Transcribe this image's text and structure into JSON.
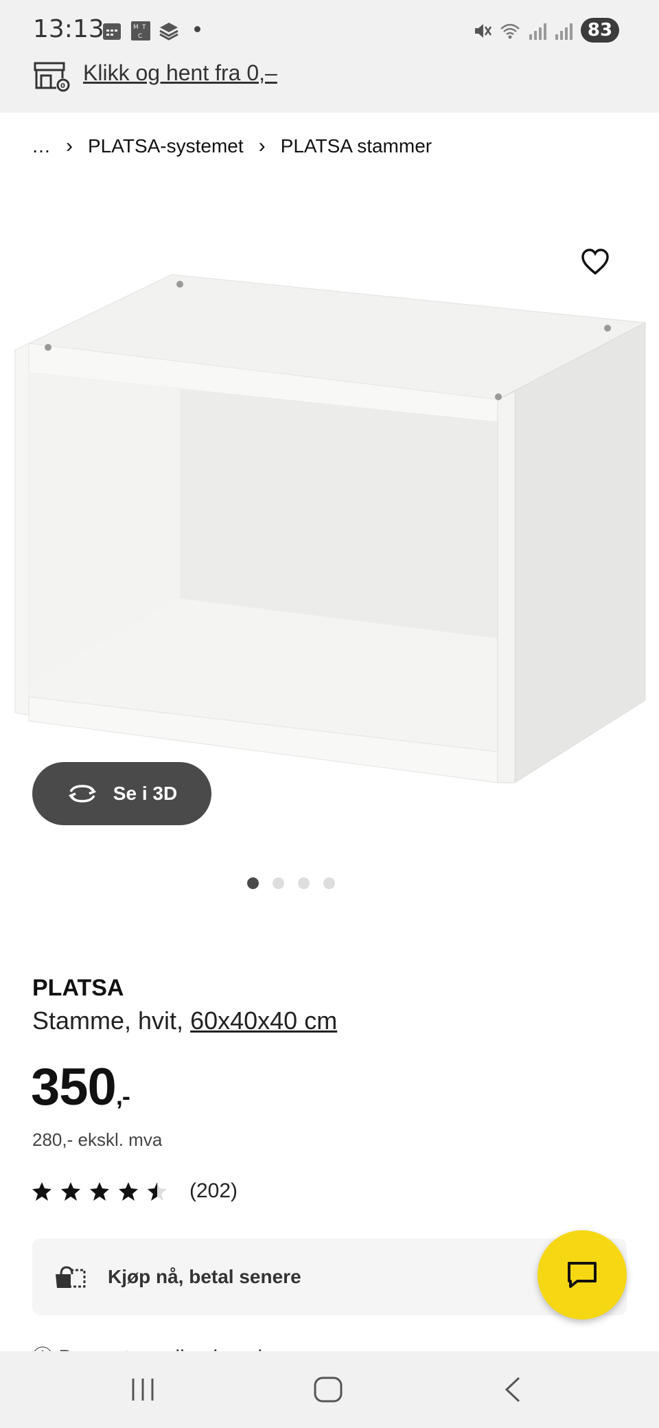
{
  "status_bar": {
    "time": "13:13",
    "battery": "83",
    "icons": [
      "calendar-icon",
      "mtc-icon",
      "stack-icon",
      "mute-icon",
      "wifi-icon",
      "signal-icon",
      "signal-r-icon"
    ]
  },
  "promo": {
    "text": "Klikk og hent fra 0,–",
    "icon": "store-pickup-icon"
  },
  "breadcrumb": {
    "items": [
      "…",
      "PLATSA-systemet",
      "PLATSA stammer"
    ]
  },
  "gallery": {
    "view_3d_label": "Se i 3D",
    "dot_count": 4,
    "active_index": 0
  },
  "product": {
    "name": "PLATSA",
    "description": "Stamme, hvit, ",
    "dimensions": "60x40x40 cm",
    "price": "350",
    "price_suffix": ",-",
    "price_ex_vat": "280,- ekskl. mva",
    "rating": 4.5,
    "rating_count": "(202)"
  },
  "buy_now": {
    "label": "Kjøp nå, betal senere"
  },
  "partial_text": "De neste mulige levering…",
  "colors": {
    "accent_yellow": "#f6d714",
    "dark_button": "#4a4a4a",
    "bar_bg": "#f2f1f1"
  }
}
